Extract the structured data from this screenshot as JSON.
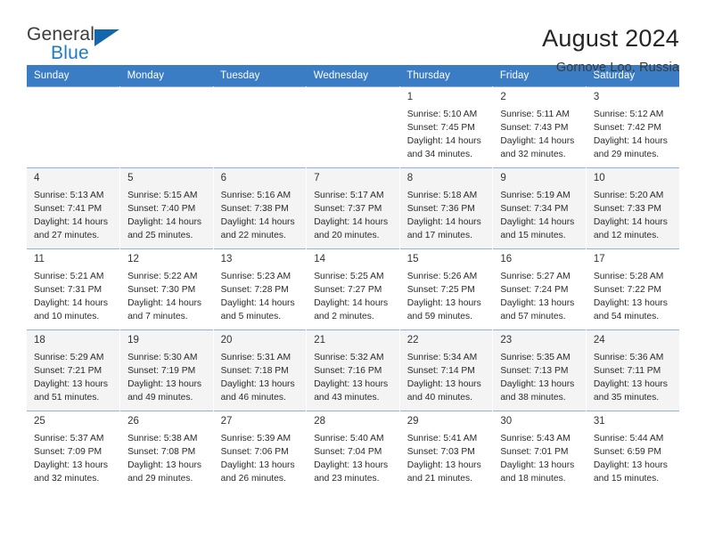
{
  "brand": {
    "word_one": "General",
    "word_two": "Blue",
    "flag_icon": "triangle-flag-icon"
  },
  "header": {
    "title": "August 2024",
    "subtitle": "Gornoye Loo, Russia"
  },
  "colors": {
    "header_bar": "#3b7dc4",
    "brand_blue": "#1f7cc4",
    "alt_row": "#f4f4f4",
    "grid_line": "#8fb4d9"
  },
  "weekdays": [
    "Sunday",
    "Monday",
    "Tuesday",
    "Wednesday",
    "Thursday",
    "Friday",
    "Saturday"
  ],
  "weeks": [
    [
      {
        "day": "",
        "info": ""
      },
      {
        "day": "",
        "info": ""
      },
      {
        "day": "",
        "info": ""
      },
      {
        "day": "",
        "info": ""
      },
      {
        "day": "1",
        "info": "Sunrise: 5:10 AM\nSunset: 7:45 PM\nDaylight: 14 hours\nand 34 minutes."
      },
      {
        "day": "2",
        "info": "Sunrise: 5:11 AM\nSunset: 7:43 PM\nDaylight: 14 hours\nand 32 minutes."
      },
      {
        "day": "3",
        "info": "Sunrise: 5:12 AM\nSunset: 7:42 PM\nDaylight: 14 hours\nand 29 minutes."
      }
    ],
    [
      {
        "day": "4",
        "info": "Sunrise: 5:13 AM\nSunset: 7:41 PM\nDaylight: 14 hours\nand 27 minutes."
      },
      {
        "day": "5",
        "info": "Sunrise: 5:15 AM\nSunset: 7:40 PM\nDaylight: 14 hours\nand 25 minutes."
      },
      {
        "day": "6",
        "info": "Sunrise: 5:16 AM\nSunset: 7:38 PM\nDaylight: 14 hours\nand 22 minutes."
      },
      {
        "day": "7",
        "info": "Sunrise: 5:17 AM\nSunset: 7:37 PM\nDaylight: 14 hours\nand 20 minutes."
      },
      {
        "day": "8",
        "info": "Sunrise: 5:18 AM\nSunset: 7:36 PM\nDaylight: 14 hours\nand 17 minutes."
      },
      {
        "day": "9",
        "info": "Sunrise: 5:19 AM\nSunset: 7:34 PM\nDaylight: 14 hours\nand 15 minutes."
      },
      {
        "day": "10",
        "info": "Sunrise: 5:20 AM\nSunset: 7:33 PM\nDaylight: 14 hours\nand 12 minutes."
      }
    ],
    [
      {
        "day": "11",
        "info": "Sunrise: 5:21 AM\nSunset: 7:31 PM\nDaylight: 14 hours\nand 10 minutes."
      },
      {
        "day": "12",
        "info": "Sunrise: 5:22 AM\nSunset: 7:30 PM\nDaylight: 14 hours\nand 7 minutes."
      },
      {
        "day": "13",
        "info": "Sunrise: 5:23 AM\nSunset: 7:28 PM\nDaylight: 14 hours\nand 5 minutes."
      },
      {
        "day": "14",
        "info": "Sunrise: 5:25 AM\nSunset: 7:27 PM\nDaylight: 14 hours\nand 2 minutes."
      },
      {
        "day": "15",
        "info": "Sunrise: 5:26 AM\nSunset: 7:25 PM\nDaylight: 13 hours\nand 59 minutes."
      },
      {
        "day": "16",
        "info": "Sunrise: 5:27 AM\nSunset: 7:24 PM\nDaylight: 13 hours\nand 57 minutes."
      },
      {
        "day": "17",
        "info": "Sunrise: 5:28 AM\nSunset: 7:22 PM\nDaylight: 13 hours\nand 54 minutes."
      }
    ],
    [
      {
        "day": "18",
        "info": "Sunrise: 5:29 AM\nSunset: 7:21 PM\nDaylight: 13 hours\nand 51 minutes."
      },
      {
        "day": "19",
        "info": "Sunrise: 5:30 AM\nSunset: 7:19 PM\nDaylight: 13 hours\nand 49 minutes."
      },
      {
        "day": "20",
        "info": "Sunrise: 5:31 AM\nSunset: 7:18 PM\nDaylight: 13 hours\nand 46 minutes."
      },
      {
        "day": "21",
        "info": "Sunrise: 5:32 AM\nSunset: 7:16 PM\nDaylight: 13 hours\nand 43 minutes."
      },
      {
        "day": "22",
        "info": "Sunrise: 5:34 AM\nSunset: 7:14 PM\nDaylight: 13 hours\nand 40 minutes."
      },
      {
        "day": "23",
        "info": "Sunrise: 5:35 AM\nSunset: 7:13 PM\nDaylight: 13 hours\nand 38 minutes."
      },
      {
        "day": "24",
        "info": "Sunrise: 5:36 AM\nSunset: 7:11 PM\nDaylight: 13 hours\nand 35 minutes."
      }
    ],
    [
      {
        "day": "25",
        "info": "Sunrise: 5:37 AM\nSunset: 7:09 PM\nDaylight: 13 hours\nand 32 minutes."
      },
      {
        "day": "26",
        "info": "Sunrise: 5:38 AM\nSunset: 7:08 PM\nDaylight: 13 hours\nand 29 minutes."
      },
      {
        "day": "27",
        "info": "Sunrise: 5:39 AM\nSunset: 7:06 PM\nDaylight: 13 hours\nand 26 minutes."
      },
      {
        "day": "28",
        "info": "Sunrise: 5:40 AM\nSunset: 7:04 PM\nDaylight: 13 hours\nand 23 minutes."
      },
      {
        "day": "29",
        "info": "Sunrise: 5:41 AM\nSunset: 7:03 PM\nDaylight: 13 hours\nand 21 minutes."
      },
      {
        "day": "30",
        "info": "Sunrise: 5:43 AM\nSunset: 7:01 PM\nDaylight: 13 hours\nand 18 minutes."
      },
      {
        "day": "31",
        "info": "Sunrise: 5:44 AM\nSunset: 6:59 PM\nDaylight: 13 hours\nand 15 minutes."
      }
    ]
  ]
}
